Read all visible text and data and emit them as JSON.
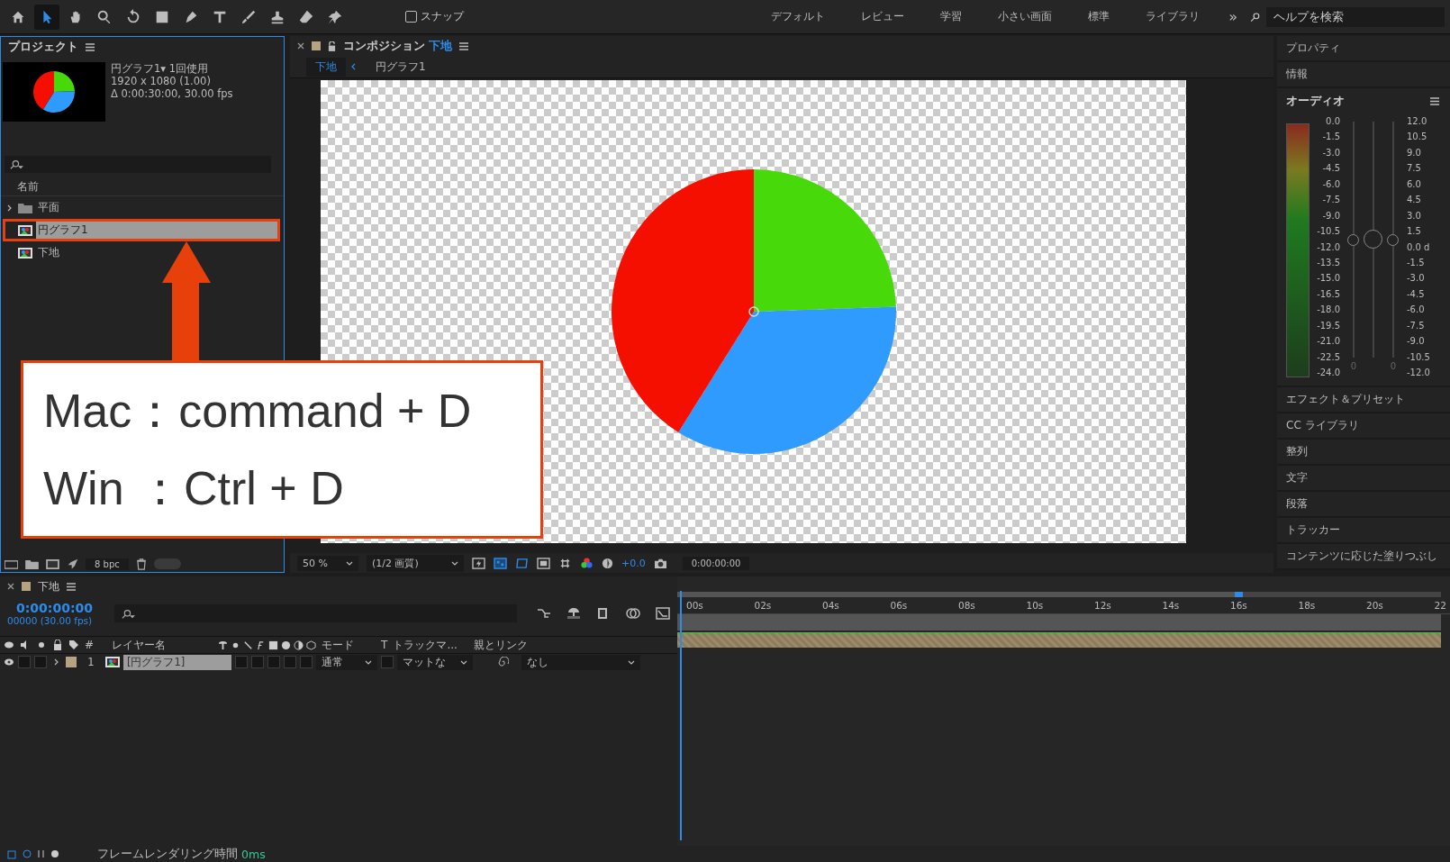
{
  "toolbar": {
    "tools": [
      {
        "kind": "home",
        "selected": false
      },
      {
        "kind": "selection",
        "selected": true
      },
      {
        "kind": "hand",
        "selected": false
      },
      {
        "kind": "zoom",
        "selected": false
      },
      {
        "kind": "rotate",
        "selected": false
      },
      {
        "kind": "rect",
        "selected": false
      },
      {
        "kind": "pen",
        "selected": false
      },
      {
        "kind": "text",
        "selected": false
      },
      {
        "kind": "brush",
        "selected": false
      },
      {
        "kind": "stamp",
        "selected": false
      },
      {
        "kind": "eraser",
        "selected": false
      },
      {
        "kind": "pin",
        "selected": false
      }
    ],
    "snap": {
      "label": "スナップ",
      "checked": false
    },
    "workspaces": [
      "デフォルト",
      "レビュー",
      "学習",
      "小さい画面",
      "標準",
      "ライブラリ"
    ],
    "more": "»",
    "help_search": {
      "placeholder": "ヘルプを検索"
    }
  },
  "project_panel": {
    "title": "プロジェクト",
    "info": [
      "円グラフ1▾  1回使用",
      "1920 x 1080 (1.00)",
      "Δ 0:00:30:00, 30.00 fps"
    ],
    "column": "名前",
    "items": [
      {
        "name": "平面",
        "kind": "folder",
        "selected": false
      },
      {
        "name": "円グラフ1",
        "kind": "comp",
        "selected": true
      },
      {
        "name": "下地",
        "kind": "comp",
        "selected": false
      }
    ],
    "bit_depth": "8 bpc",
    "footer_toggle": {
      "on": false
    }
  },
  "composition_panel": {
    "title": "コンポジション",
    "comp_name": "下地",
    "breadcrumbs": [
      {
        "label": "下地",
        "selected": true
      },
      {
        "label": "円グラフ1",
        "selected": false
      }
    ],
    "zoom": "50 %",
    "resolution": "(1/2 画質)",
    "exposure": "+0.0",
    "timecode": "0:00:00:00"
  },
  "right_panel": {
    "top_panels": [
      "プロパティ",
      "情報"
    ],
    "audio": {
      "title": "オーディオ",
      "left_scale": [
        "0.0",
        "-1.5",
        "-3.0",
        "-4.5",
        "-6.0",
        "-7.5",
        "-9.0",
        "-10.5",
        "-12.0",
        "-13.5",
        "-15.0",
        "-16.5",
        "-18.0",
        "-19.5",
        "-21.0",
        "-22.5",
        "-24.0"
      ],
      "right_scale": [
        "12.0",
        "10.5",
        "9.0",
        "7.5",
        "6.0",
        "4.5",
        "3.0",
        "1.5",
        "0.0 d",
        "-1.5",
        "-3.0",
        "-4.5",
        "-6.0",
        "-7.5",
        "-9.0",
        "-10.5",
        "-12.0"
      ],
      "sliders": [
        {
          "kind": "channel",
          "level": 0.5,
          "reading": "0"
        },
        {
          "kind": "master",
          "level": 0.5
        },
        {
          "kind": "channel",
          "level": 0.5,
          "reading": "0"
        }
      ]
    },
    "bottom_panels": [
      "エフェクト＆プリセット",
      "CC ライブラリ",
      "整列",
      "文字",
      "段落",
      "トラッカー",
      "コンテンツに応じた塗りつぶし"
    ]
  },
  "timeline": {
    "tab": "下地",
    "timecode": "0:00:00:00",
    "frames": "00000 (30.00 fps)",
    "columns": {
      "number": "#",
      "layer_name": "レイヤー名",
      "mode": "モード",
      "t": "T",
      "track_matte": "トラックマ...",
      "parent": "親とリンク"
    },
    "layers": [
      {
        "number": "1",
        "name": "[円グラフ1]",
        "mode": "通常",
        "track_matte": "マットな",
        "parent": "なし",
        "selected": true
      }
    ],
    "ruler": [
      "00s",
      "02s",
      "04s",
      "06s",
      "08s",
      "10s",
      "12s",
      "14s",
      "16s",
      "18s",
      "20s",
      "22"
    ]
  },
  "status_bar": {
    "label": "フレームレンダリング時間",
    "value": "0ms"
  },
  "callout": {
    "lines": [
      "Mac：command + D",
      "Win ：Ctrl + D"
    ]
  }
}
